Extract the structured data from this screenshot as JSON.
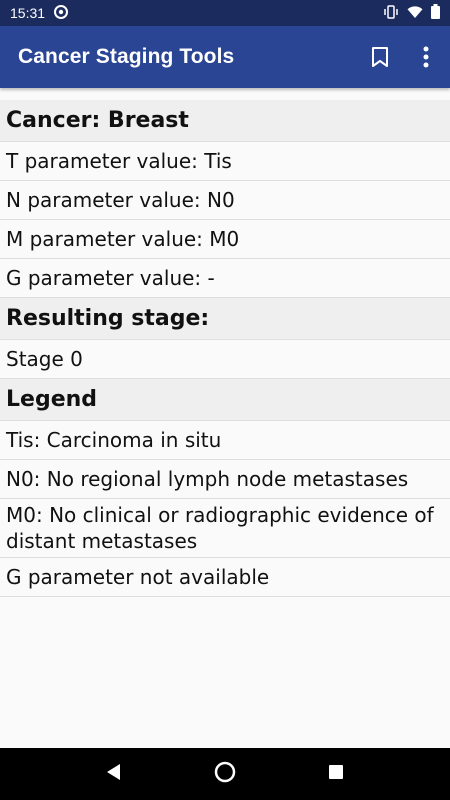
{
  "status_bar": {
    "time": "15:31"
  },
  "app_bar": {
    "title": "Cancer Staging Tools",
    "icons": [
      "bookmark-icon",
      "more-vert-icon"
    ]
  },
  "sections": {
    "cancer_header": "Cancer: Breast",
    "t_param": "T parameter value: Tis",
    "n_param": "N parameter value: N0",
    "m_param": "M parameter value: M0",
    "g_param": "G parameter value: -",
    "resulting_header": "Resulting stage:",
    "stage": "Stage 0",
    "legend_header": "Legend",
    "legend_tis": "Tis: Carcinoma in situ",
    "legend_n0": "N0: No regional lymph node metastases",
    "legend_m0": "M0: No clinical or radiographic evidence of distant metastases",
    "legend_g": "G parameter not available"
  },
  "colors": {
    "app_bar": "#2a4593",
    "status_bar": "#1b2b5e",
    "section_header_bg": "#efefef"
  }
}
